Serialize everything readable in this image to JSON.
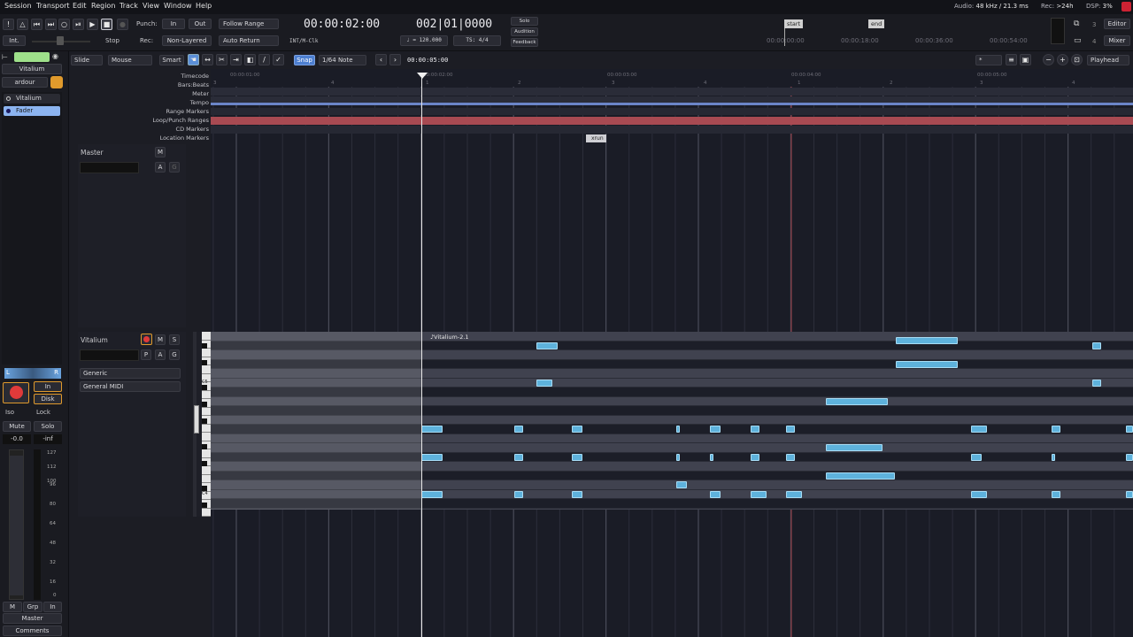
{
  "menu": [
    "Session",
    "Transport",
    "Edit",
    "Region",
    "Track",
    "View",
    "Window",
    "Help"
  ],
  "status": {
    "audio_label": "Audio:",
    "audio_value": "48 kHz / 21.3 ms",
    "rec_label": "Rec:",
    "rec_value": ">24h",
    "dsp_label": "DSP:",
    "dsp_value": "3%"
  },
  "transport": {
    "punch_label": "Punch:",
    "punch_in": "In",
    "punch_out": "Out",
    "follow_range": "Follow Range",
    "rec_label": "Rec:",
    "non_layered": "Non-Layered",
    "auto_return": "Auto Return",
    "stop_label": "Stop",
    "int_label": "Int.",
    "primary_clock": "00:00:02:00",
    "sync_label": "INT/M-Clk",
    "secondary_clock": "002|01|0000",
    "tempo": "♩ = 120.000",
    "ts": "TS: 4/4",
    "solo": "Solo",
    "audition": "Audition",
    "feedback": "Feedback",
    "mini_marks": [
      "start",
      "end"
    ],
    "mini_times": [
      "00:00:00:00",
      "00:00:18:00",
      "00:00:36:00",
      "00:00:54:00"
    ],
    "editor_btn": "Editor",
    "mixer_btn": "Mixer",
    "counter3": "3",
    "counter4": "4"
  },
  "edit_tools": {
    "mode": "Slide",
    "mouse": "Mouse",
    "smart": "Smart",
    "snap": "Snap",
    "grid": "1/64 Note",
    "nudge_clock": "00:00:05:00",
    "zoom_focus": "*",
    "playhead": "Playhead"
  },
  "left_strip": {
    "plugin_name": "Vitalium",
    "owner": "ardour",
    "proc_vitalium": "Vitalium",
    "proc_fader": "Fader",
    "pan_l": "L",
    "pan_r": "R",
    "in_btn": "In",
    "disk_btn": "Disk",
    "iso": "Iso",
    "lock": "Lock",
    "mute": "Mute",
    "solo": "Solo",
    "gain": "-0.0",
    "peak": "-inf",
    "scale": [
      "127",
      "112",
      "100",
      "96",
      "80",
      "64",
      "48",
      "32",
      "16",
      "0"
    ],
    "bottom_m": "M",
    "bottom_grp": "Grp",
    "bottom_in": "In",
    "master": "Master",
    "comments": "Comments"
  },
  "rulers": [
    "Timecode",
    "Bars:Beats",
    "Meter",
    "Tempo",
    "Range Markers",
    "Loop/Punch Ranges",
    "CD Markers",
    "Location Markers"
  ],
  "timecode_ticks": [
    "00:00:01:00",
    "00:00:02:00",
    "00:00:03:00",
    "00:00:04:00",
    "00:00:05:00"
  ],
  "bar_ticks": [
    "3",
    "4",
    "1",
    "2",
    "3",
    "4",
    "1",
    "2",
    "3",
    "4"
  ],
  "xrun_marker": "xrun",
  "master_track": {
    "name": "Master",
    "m": "M",
    "a": "A",
    "g": "G"
  },
  "midi_track": {
    "name": "Vitalium",
    "m": "M",
    "s": "S",
    "p": "P",
    "a": "A",
    "g": "G",
    "instrument": "Generic",
    "midi_mode": "General MIDI",
    "region_name": "♪Vitalium-2.1",
    "c5": "C5",
    "c4": "C4"
  }
}
